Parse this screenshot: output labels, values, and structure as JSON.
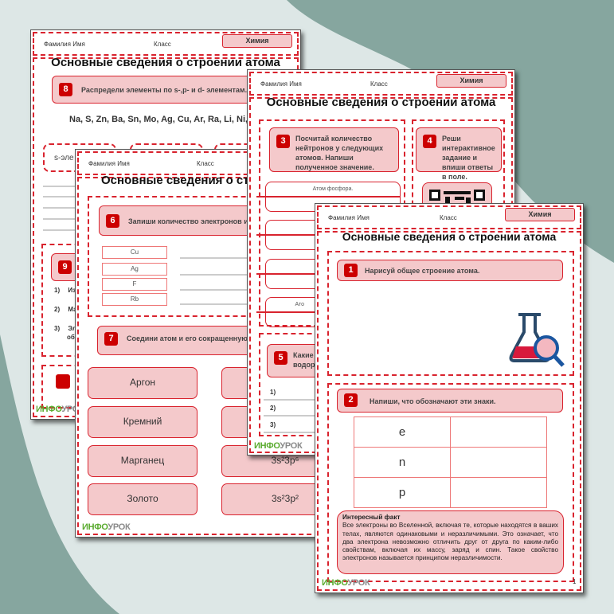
{
  "colors": {
    "accent": "#d9232e",
    "badge": "#cc0000",
    "fill": "#f4c9cb",
    "background": "#dde7e6",
    "blob": "#86a69f"
  },
  "header": {
    "name_label": "Фамилия Имя",
    "class_label": "Класс",
    "subject": "Химия"
  },
  "title": "Основные сведения о строении атома",
  "title_cut": "Основные сведения о стро",
  "logo": {
    "part1": "ИНФО",
    "part2": "УРОК"
  },
  "page1": {
    "task8": {
      "num": "8",
      "text": "Распредели элементы по s-,p- и d- элементам."
    },
    "elements": "Na, S, Zn, Ba, Sn, Mo, Ag, Cu, Ar, Ra, Li, Ni, Ca",
    "s_box": "s-эле",
    "task9": {
      "num": "9",
      "items": [
        {
          "n": "1)",
          "t": "Из"
        },
        {
          "n": "2)",
          "t": "Ма"
        },
        {
          "n": "3)",
          "t": "Эл"
        }
      ],
      "item3_line2": "об"
    }
  },
  "page3": {
    "task6": {
      "num": "6",
      "text": "Запиши количество электронов и пр"
    },
    "atoms": [
      "Cu",
      "Ag",
      "F",
      "Rb"
    ],
    "task7": {
      "num": "7",
      "text": "Соедини атом и его сокращенную эл конфигурацию ."
    },
    "left_options": [
      "Аргон",
      "Кремний",
      "Марганец",
      "Золото"
    ],
    "right_options": [
      "3s²3p⁶",
      "3s²3p²"
    ]
  },
  "page2": {
    "task3": {
      "num": "3",
      "text": "Посчитай количество нейтронов у следующих атомов. Напиши полученное значение."
    },
    "atom_boxes": [
      "Атом фосфора.",
      "А",
      "А",
      "Ато"
    ],
    "task4": {
      "num": "4",
      "text": "Реши интерактивное задание и впиши ответы в поле."
    },
    "task5": {
      "num": "5",
      "text": "Какие водор"
    },
    "items": [
      "1)",
      "2)",
      "3)"
    ]
  },
  "page4": {
    "task1": {
      "num": "1",
      "text": "Нарисуй общее строение атома."
    },
    "flask_icon": "flask-magnifier-icon",
    "task2": {
      "num": "2",
      "text": "Напиши, что обозначают эти знаки."
    },
    "symbols": [
      "e",
      "n",
      "p"
    ],
    "fact": {
      "title": "Интересный факт",
      "text": "Все электроны во Вселенной, включая те, которые находятся в ваших телах, являются одинаковыми и неразличимыми. Это означает, что два электрона невозможно отличить друг от друга по каким-либо свойствам, включая их массу, заряд и спин. Такое свойство электронов называется принципом неразличимости."
    },
    "page_number": "1"
  }
}
